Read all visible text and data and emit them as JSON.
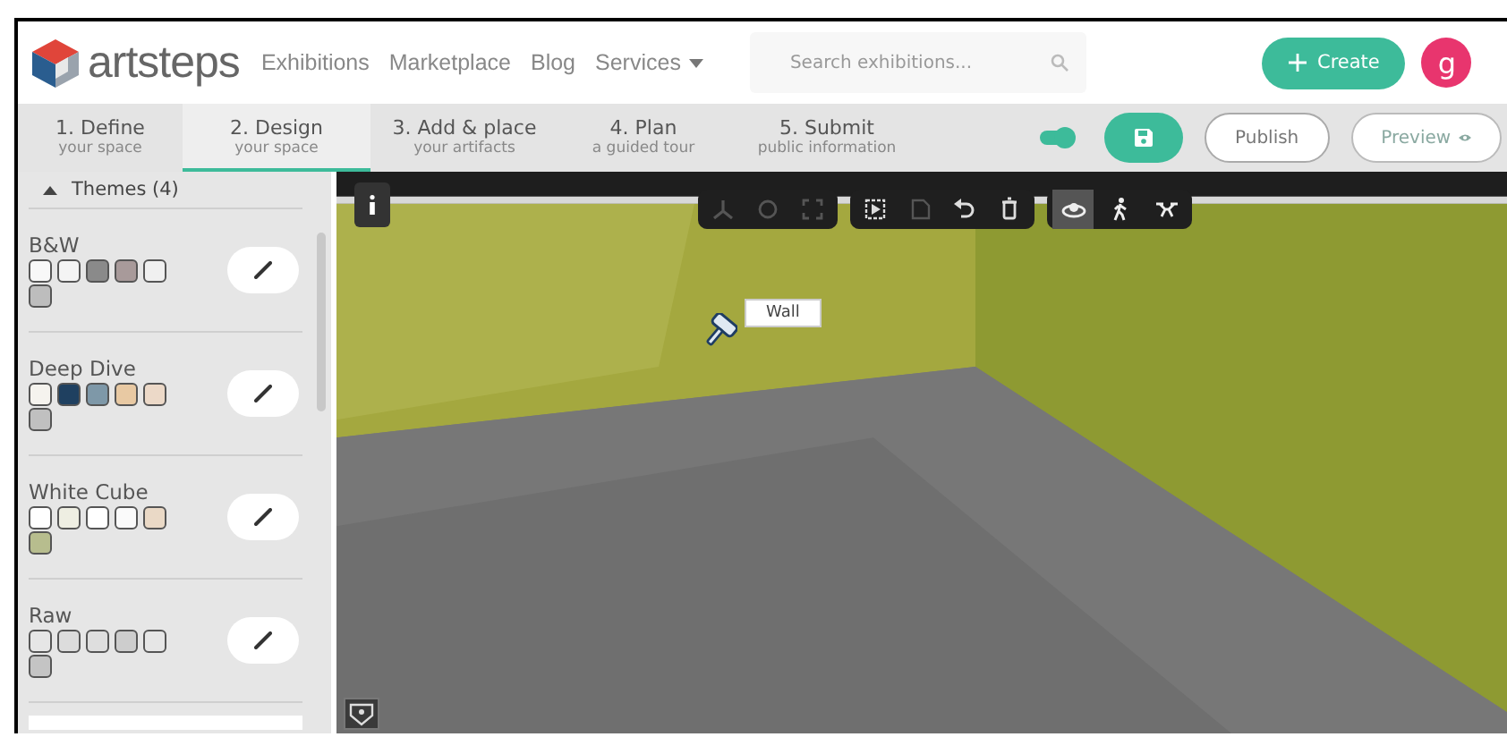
{
  "header": {
    "logo": "artsteps",
    "nav": [
      {
        "label": "Exhibitions",
        "dropdown": false
      },
      {
        "label": "Marketplace",
        "dropdown": false
      },
      {
        "label": "Blog",
        "dropdown": false
      },
      {
        "label": "Services",
        "dropdown": true
      }
    ],
    "search": {
      "placeholder": "Search exhibitions..."
    },
    "create_button": "Create",
    "avatar": "g"
  },
  "steps": [
    {
      "title": "1. Define",
      "subtitle": "your space",
      "selected": false
    },
    {
      "title": "2. Design",
      "subtitle": "your space",
      "selected": true
    },
    {
      "title": "3. Add & place",
      "subtitle": "your artifacts",
      "selected": false
    },
    {
      "title": "4. Plan",
      "subtitle": "a guided tour",
      "selected": false
    },
    {
      "title": "5. Submit",
      "subtitle": "public information",
      "selected": false
    }
  ],
  "actions": {
    "toggle_on": true,
    "publish": "Publish",
    "preview": {
      "label": "Preview",
      "disabled": true
    }
  },
  "sidebar": {
    "section": {
      "title": "Themes (4)",
      "expanded": true
    },
    "themes": [
      {
        "name": "B&W",
        "swatches": [
          {
            "color": "#f8f8f8"
          },
          {
            "color": "#f4f4f4"
          },
          {
            "color": "#8a8a8a"
          },
          {
            "color": "#a89a9a"
          },
          {
            "color": "#f0f0f0"
          },
          {
            "color": "#bdbdbd"
          }
        ]
      },
      {
        "name": "Deep Dive",
        "swatches": [
          {
            "color": "#f5f3ee"
          },
          {
            "color": "#1f4060"
          },
          {
            "color": "#7e98a8"
          },
          {
            "color": "#e8c9a3"
          },
          {
            "color": "#ecd9c8"
          },
          {
            "color": "#c0c0c0"
          }
        ]
      },
      {
        "name": "White Cube",
        "swatches": [
          {
            "color": "#ffffff"
          },
          {
            "color": "#eeeee2"
          },
          {
            "color": "#ffffff"
          },
          {
            "color": "#fafafa"
          },
          {
            "color": "#ead9c6"
          },
          {
            "color": "#b7bd8e"
          }
        ]
      },
      {
        "name": "Raw",
        "swatches": [
          {
            "color": "#e6e6e6"
          },
          {
            "color": "#dcdcdc"
          },
          {
            "color": "#dedede"
          },
          {
            "color": "#cdcdcd"
          },
          {
            "color": "#e6e6e6"
          },
          {
            "color": "#c4c4c4"
          }
        ]
      }
    ]
  },
  "toolbar": {
    "groups": [
      [
        {
          "kind": "axes",
          "disabled": true
        },
        {
          "kind": "rotate",
          "disabled": true
        },
        {
          "kind": "expand",
          "disabled": true
        }
      ],
      [
        {
          "kind": "select",
          "disabled": false
        },
        {
          "kind": "copy",
          "disabled": true
        },
        {
          "kind": "undo",
          "disabled": false
        },
        {
          "kind": "trash",
          "disabled": false
        }
      ]
    ],
    "modes": [
      {
        "kind": "orbit",
        "selected": true
      },
      {
        "kind": "walk",
        "selected": false
      },
      {
        "kind": "drone",
        "selected": false
      }
    ]
  },
  "tooltip": "Wall"
}
